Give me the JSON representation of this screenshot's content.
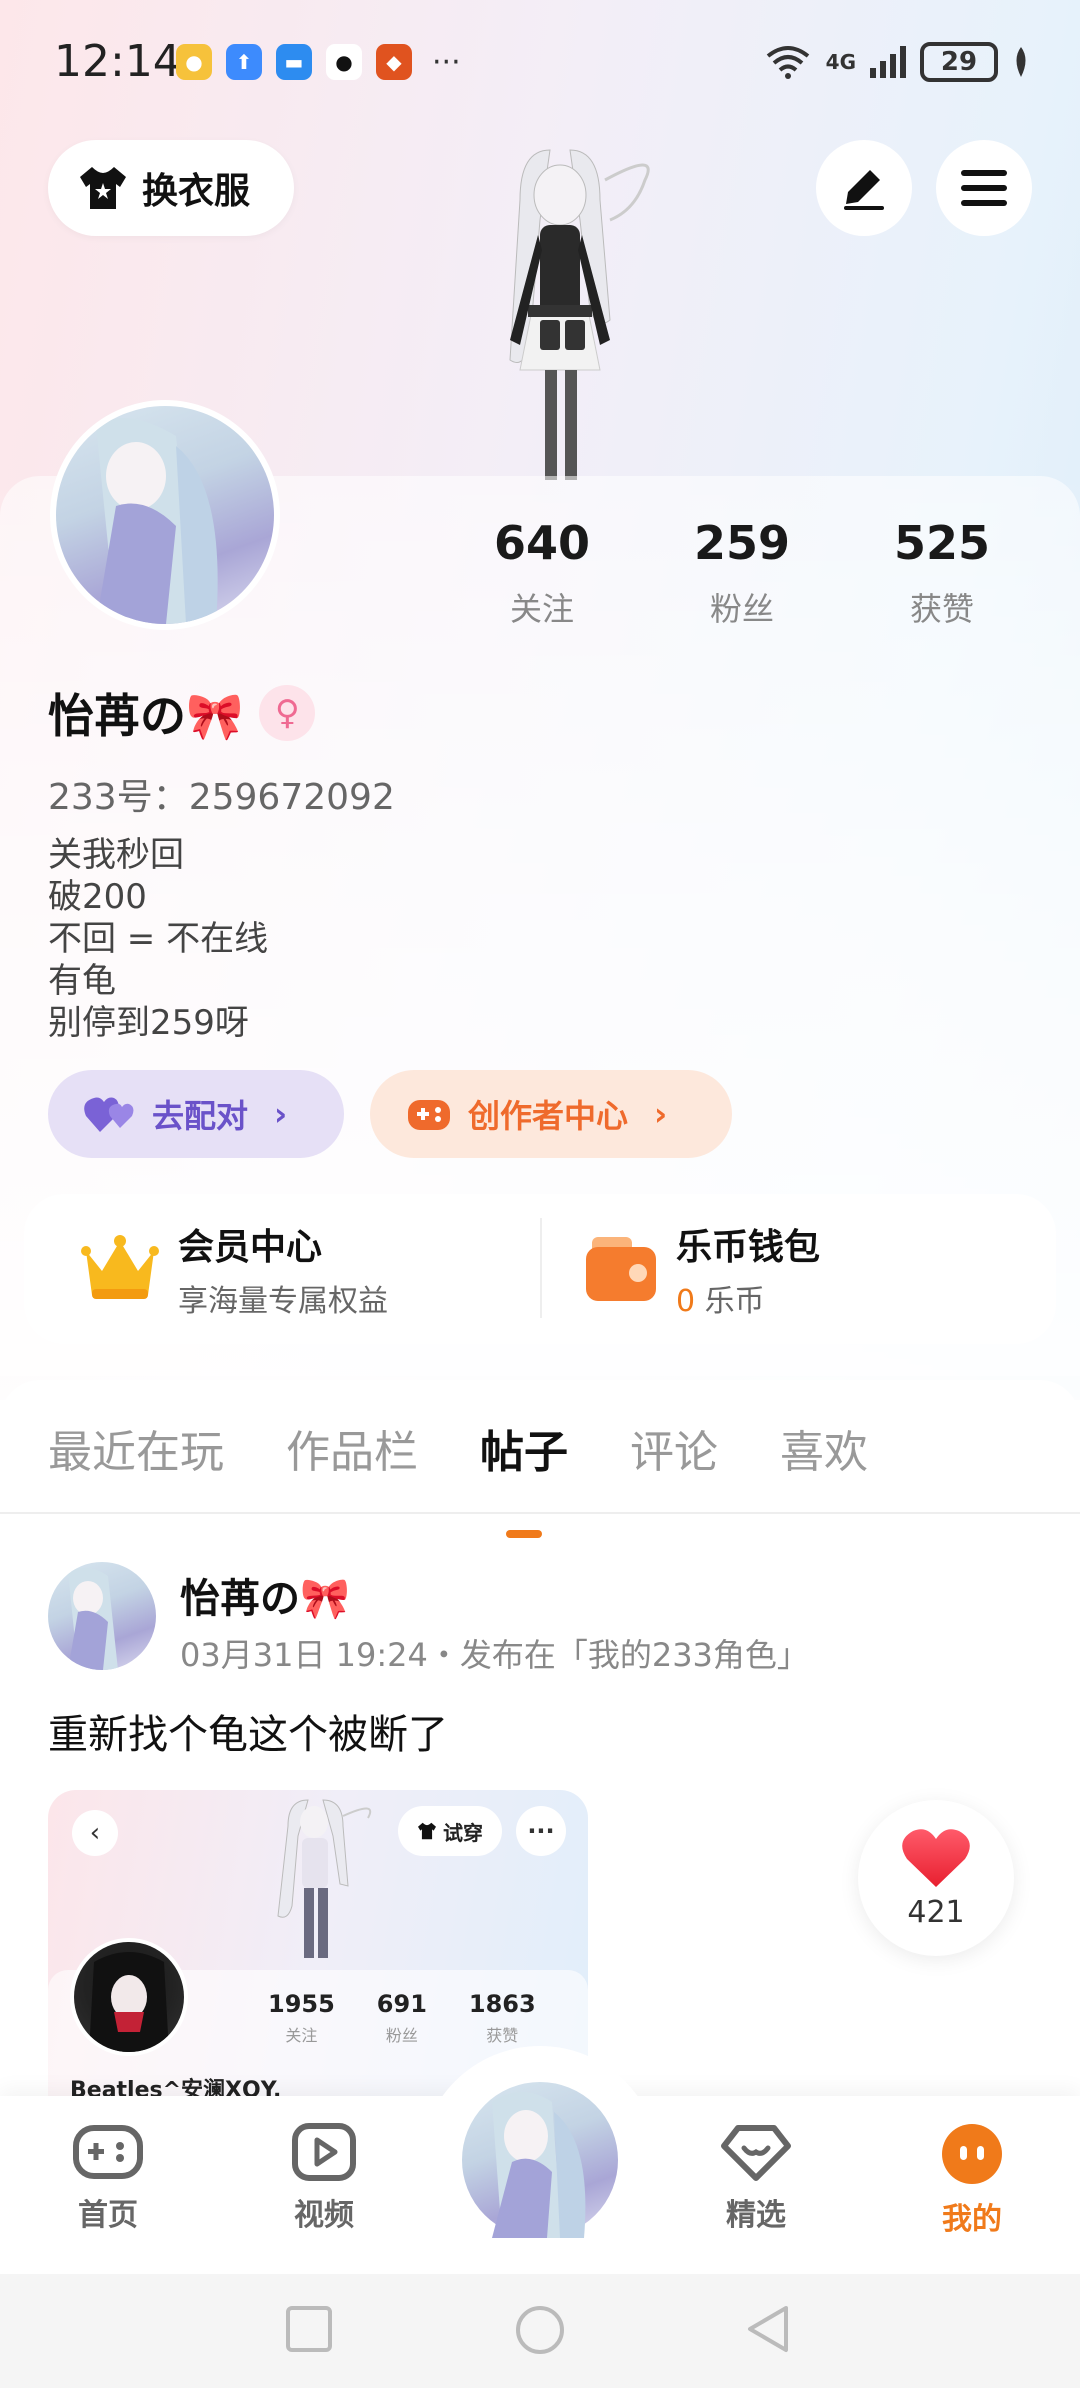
{
  "status_bar": {
    "time": "12:14",
    "battery": "29",
    "network": "4G",
    "more": "···"
  },
  "header": {
    "outfit_label": "换衣服",
    "edit_icon": "pen-icon",
    "menu_icon": "hamburger-menu-icon"
  },
  "profile": {
    "username": "怡苒の🎀",
    "gender_symbol": "♀",
    "uid": "233号：259672092",
    "bio": [
      "关我秒回",
      "破200",
      "不回 = 不在线",
      "有龟",
      "别停到259呀"
    ],
    "stats": [
      {
        "value": "640",
        "label": "关注"
      },
      {
        "value": "259",
        "label": "粉丝"
      },
      {
        "value": "525",
        "label": "获赞"
      }
    ]
  },
  "actions": {
    "match_label": "去配对",
    "creator_label": "创作者中心",
    "chevron": "›"
  },
  "member": {
    "vip_title": "会员中心",
    "vip_sub": "享海量专属权益",
    "wallet_title": "乐币钱包",
    "wallet_amount": "0",
    "wallet_unit": " 乐币"
  },
  "tabs": [
    {
      "label": "最近在玩"
    },
    {
      "label": "作品栏"
    },
    {
      "label": "帖子"
    },
    {
      "label": "评论"
    },
    {
      "label": "喜欢"
    }
  ],
  "post": {
    "author": "怡苒の🎀",
    "meta": "03月31日 19:24・发布在「我的233角色」",
    "text": "重新找个龟这个被断了",
    "embedded": {
      "back": "‹",
      "try_label": "试穿",
      "more": "···",
      "stats": [
        {
          "value": "1955",
          "label": "关注"
        },
        {
          "value": "691",
          "label": "粉丝"
        },
        {
          "value": "1863",
          "label": "获赞"
        }
      ],
      "name": "Beatles^安澜XQY."
    },
    "likes": "421"
  },
  "bottom_nav": [
    {
      "label": "首页",
      "icon": "gamepad-icon"
    },
    {
      "label": "视频",
      "icon": "video-play-icon"
    },
    {
      "label": "精选",
      "icon": "heart-gem-icon"
    },
    {
      "label": "我的",
      "icon": "face-icon"
    }
  ],
  "colors": {
    "accent": "#f07a1a",
    "match": "#6a52c9",
    "creator": "#ef6a2c"
  }
}
